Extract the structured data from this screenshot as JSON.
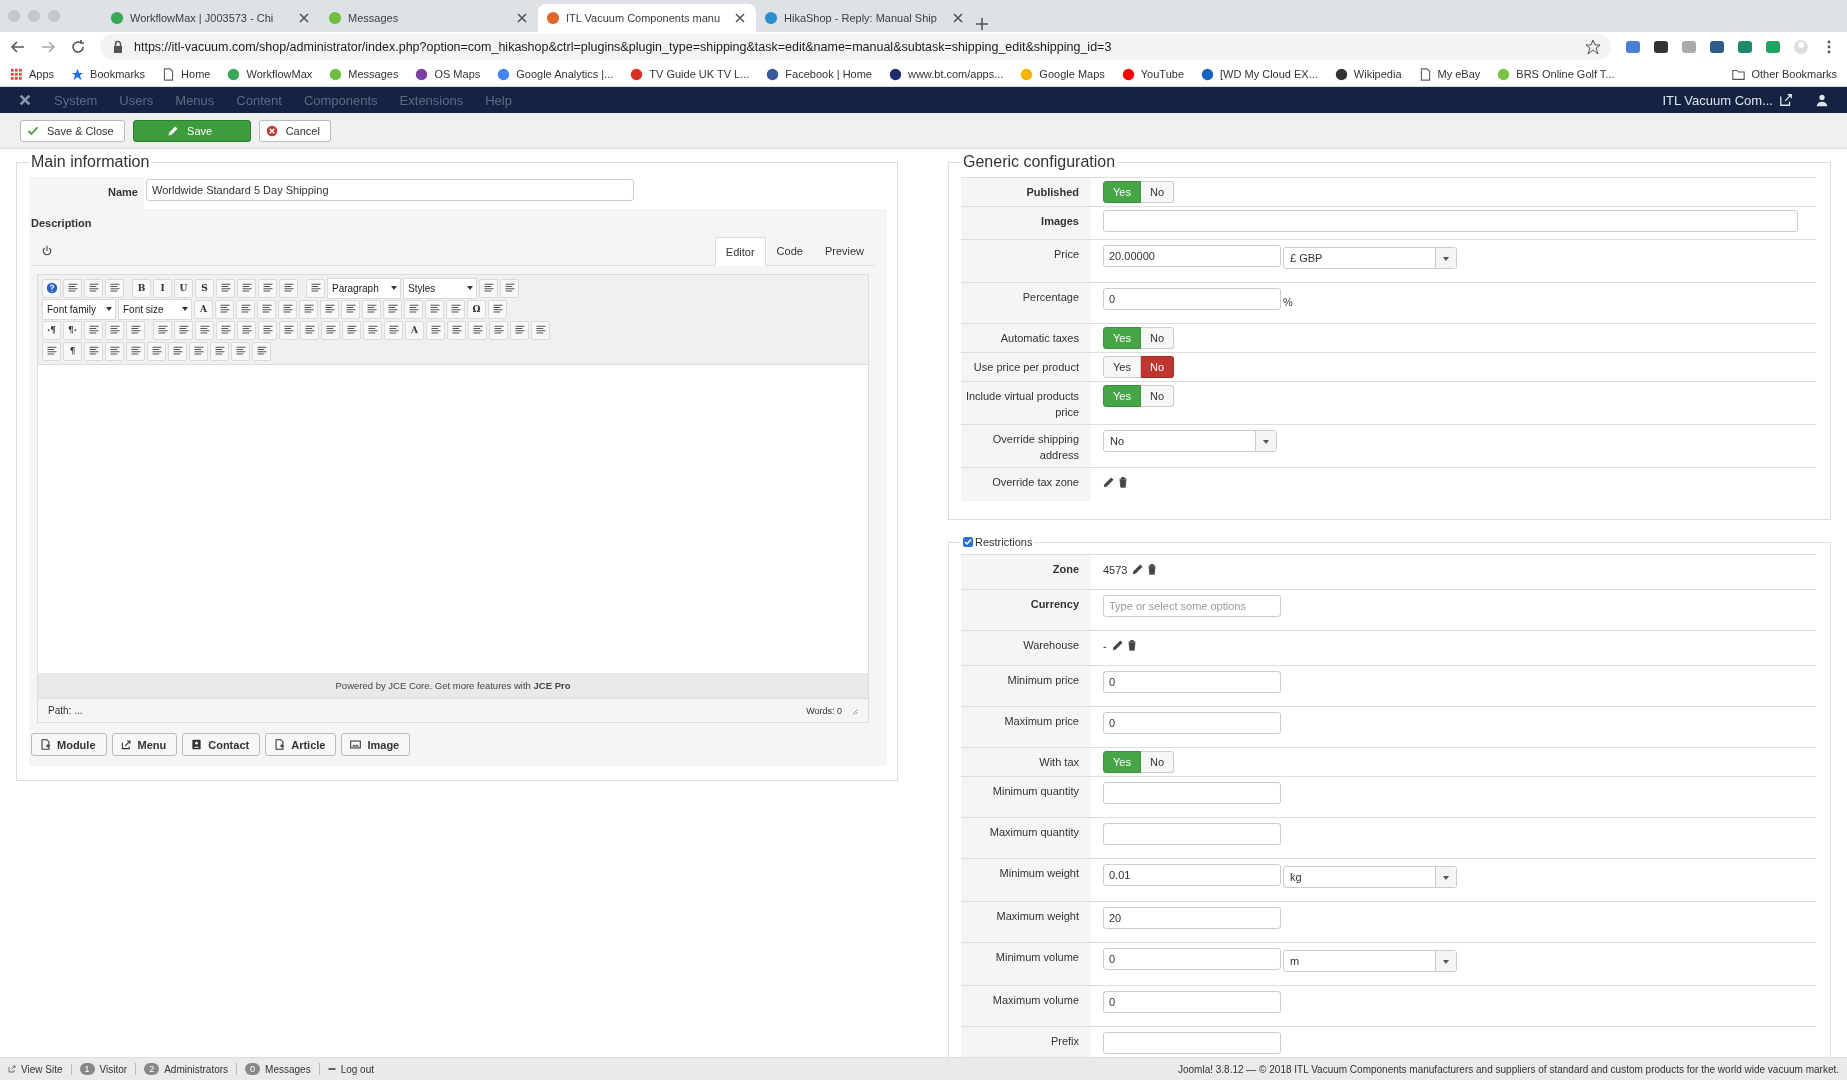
{
  "browser": {
    "tabs": [
      {
        "title": "WorkflowMax | J003573 - Chi",
        "color": "#3aa856",
        "selected": false
      },
      {
        "title": "Messages",
        "color": "#6fbf3f",
        "selected": false
      },
      {
        "title": "ITL Vacuum Components manu",
        "color": "#e0662b",
        "selected": true
      },
      {
        "title": "HikaShop - Reply: Manual Ship",
        "color": "#2d8fd0",
        "selected": false
      }
    ],
    "url": "https://itl-vacuum.com/shop/administrator/index.php?option=com_hikashop&ctrl=plugins&plugin_type=shipping&task=edit&name=manual&subtask=shipping_edit&shipping_id=3",
    "bookmarks": [
      {
        "label": "Apps",
        "kind": "grid",
        "color": "#e04a3f"
      },
      {
        "label": "Bookmarks",
        "kind": "star",
        "color": "#1a73e8"
      },
      {
        "label": "Home",
        "kind": "page",
        "color": "#5f6368"
      },
      {
        "label": "WorkflowMax",
        "kind": "dot",
        "color": "#3aa856"
      },
      {
        "label": "Messages",
        "kind": "dot",
        "color": "#6fbf3f"
      },
      {
        "label": "OS Maps",
        "kind": "dot",
        "color": "#7b3fa0"
      },
      {
        "label": "Google Analytics |...",
        "kind": "dot",
        "color": "#4285f4"
      },
      {
        "label": "TV Guide UK TV L...",
        "kind": "dot",
        "color": "#d93025"
      },
      {
        "label": "Facebook | Home",
        "kind": "dot",
        "color": "#3b5998"
      },
      {
        "label": "www.bt.com/apps...",
        "kind": "dot",
        "color": "#1f2b6e"
      },
      {
        "label": "Google Maps",
        "kind": "dot",
        "color": "#f4b400"
      },
      {
        "label": "YouTube",
        "kind": "dot",
        "color": "#ff0000"
      },
      {
        "label": "[WD My Cloud EX...",
        "kind": "dot",
        "color": "#1565c0"
      },
      {
        "label": "Wikipedia",
        "kind": "dot",
        "color": "#333333"
      },
      {
        "label": "My eBay",
        "kind": "page",
        "color": "#5f6368"
      },
      {
        "label": "BRS Online Golf T...",
        "kind": "dot",
        "color": "#7cc242"
      }
    ],
    "other_bookmarks": "Other Bookmarks"
  },
  "admin_menu": {
    "items": [
      "System",
      "Users",
      "Menus",
      "Content",
      "Components",
      "Extensions",
      "Help"
    ],
    "site_link": "ITL Vacuum Com..."
  },
  "toolbar": [
    {
      "label": "Save & Close",
      "kind": "check"
    },
    {
      "label": "Save",
      "kind": "primary"
    },
    {
      "label": "Cancel",
      "kind": "cancel"
    }
  ],
  "main_information": {
    "title": "Main information",
    "name_label": "Name",
    "name_value": "Worldwide Standard 5 Day Shipping",
    "description_label": "Description",
    "editor_tabs": [
      {
        "label": "Editor",
        "selected": true
      },
      {
        "label": "Code",
        "selected": false
      },
      {
        "label": "Preview",
        "selected": false
      }
    ],
    "editor_toolbar": [
      [
        {
          "kind": "help"
        },
        {
          "kind": "icon"
        },
        {
          "kind": "icon"
        },
        {
          "kind": "icon"
        },
        {
          "kind": "sep"
        },
        {
          "kind": "glyph",
          "text": "B"
        },
        {
          "kind": "glyph",
          "text": "I"
        },
        {
          "kind": "glyph",
          "text": "U"
        },
        {
          "kind": "glyph",
          "text": "S"
        },
        {
          "kind": "icon"
        },
        {
          "kind": "icon"
        },
        {
          "kind": "icon"
        },
        {
          "kind": "icon"
        },
        {
          "kind": "sep"
        },
        {
          "kind": "icon"
        },
        {
          "kind": "select",
          "text": "Paragraph"
        },
        {
          "kind": "select",
          "text": "Styles"
        },
        {
          "kind": "icon"
        },
        {
          "kind": "icon"
        }
      ],
      [
        {
          "kind": "select",
          "text": "Font family"
        },
        {
          "kind": "select",
          "text": "Font size"
        },
        {
          "kind": "glyph",
          "text": "A"
        },
        {
          "kind": "icon"
        },
        {
          "kind": "icon"
        },
        {
          "kind": "icon"
        },
        {
          "kind": "icon"
        },
        {
          "kind": "icon"
        },
        {
          "kind": "icon"
        },
        {
          "kind": "icon"
        },
        {
          "kind": "icon"
        },
        {
          "kind": "icon"
        },
        {
          "kind": "icon"
        },
        {
          "kind": "icon"
        },
        {
          "kind": "icon"
        },
        {
          "kind": "glyph",
          "text": "Ω"
        },
        {
          "kind": "icon"
        }
      ],
      [
        {
          "kind": "glyph",
          "text": "·¶"
        },
        {
          "kind": "glyph",
          "text": "¶·"
        },
        {
          "kind": "icon"
        },
        {
          "kind": "icon"
        },
        {
          "kind": "icon"
        },
        {
          "kind": "sep"
        },
        {
          "kind": "icon"
        },
        {
          "kind": "icon"
        },
        {
          "kind": "icon"
        },
        {
          "kind": "icon"
        },
        {
          "kind": "icon"
        },
        {
          "kind": "icon"
        },
        {
          "kind": "icon"
        },
        {
          "kind": "icon"
        },
        {
          "kind": "icon"
        },
        {
          "kind": "icon"
        },
        {
          "kind": "icon"
        },
        {
          "kind": "icon"
        },
        {
          "kind": "glyph",
          "text": "A"
        },
        {
          "kind": "icon"
        },
        {
          "kind": "icon"
        },
        {
          "kind": "icon"
        },
        {
          "kind": "icon"
        },
        {
          "kind": "icon"
        },
        {
          "kind": "icon"
        }
      ],
      [
        {
          "kind": "icon"
        },
        {
          "kind": "glyph",
          "text": "¶"
        },
        {
          "kind": "icon"
        },
        {
          "kind": "icon"
        },
        {
          "kind": "icon"
        },
        {
          "kind": "icon"
        },
        {
          "kind": "icon"
        },
        {
          "kind": "icon"
        },
        {
          "kind": "icon"
        },
        {
          "kind": "icon"
        },
        {
          "kind": "icon"
        }
      ]
    ],
    "editor_footer": "Powered by JCE Core. Get more features with **JCE Pro**",
    "path": "Path: ...",
    "words": "Words: 0",
    "insert_buttons": [
      {
        "label": "Module",
        "kind": "doc"
      },
      {
        "label": "Menu",
        "kind": "share"
      },
      {
        "label": "Contact",
        "kind": "card"
      },
      {
        "label": "Article",
        "kind": "doc"
      },
      {
        "label": "Image",
        "kind": "picture"
      }
    ]
  },
  "generic_configuration": {
    "title": "Generic configuration",
    "rows": [
      {
        "label": "Published",
        "strong": true,
        "kind": "toggle",
        "options": [
          {
            "label": "Yes",
            "kind": "yes",
            "selected": true
          },
          {
            "label": "No",
            "kind": "no",
            "selected": false
          }
        ]
      },
      {
        "label": "Images",
        "strong": true,
        "kind": "wide_input"
      },
      {
        "label": "Price",
        "strong": false,
        "kind": "input",
        "value": "20.00000",
        "select": "£ GBP"
      },
      {
        "label": "Percentage",
        "strong": false,
        "kind": "input",
        "value": "0",
        "suffix": "%"
      },
      {
        "label": "Automatic taxes",
        "strong": false,
        "kind": "toggle",
        "options": [
          {
            "label": "Yes",
            "kind": "yes",
            "selected": true
          },
          {
            "label": "No",
            "kind": "no",
            "selected": false
          }
        ]
      },
      {
        "label": "Use price per product",
        "strong": false,
        "kind": "toggle",
        "options": [
          {
            "label": "Yes",
            "kind": "yes",
            "selected": false
          },
          {
            "label": "No",
            "kind": "no",
            "selected": true
          }
        ]
      },
      {
        "label": "Include virtual products price",
        "strong": false,
        "kind": "toggle",
        "options": [
          {
            "label": "Yes",
            "kind": "yes",
            "selected": true
          },
          {
            "label": "No",
            "kind": "no",
            "selected": false
          }
        ]
      },
      {
        "label": "Override shipping address",
        "strong": false,
        "kind": "select",
        "value": "No"
      },
      {
        "label": "Override tax zone",
        "strong": false,
        "kind": "icons"
      }
    ]
  },
  "restrictions": {
    "title": "Restrictions",
    "checked": true,
    "rows": [
      {
        "label": "Zone",
        "strong": true,
        "kind": "icons",
        "value": "4573"
      },
      {
        "label": "Currency",
        "strong": true,
        "kind": "input",
        "placeholder": "Type or select some options"
      },
      {
        "label": "Warehouse",
        "strong": false,
        "kind": "icons",
        "value": "-"
      },
      {
        "label": "Minimum price",
        "strong": false,
        "kind": "input",
        "value": "0"
      },
      {
        "label": "Maximum price",
        "strong": false,
        "kind": "input",
        "value": "0"
      },
      {
        "label": "With tax",
        "strong": false,
        "kind": "toggle",
        "options": [
          {
            "label": "Yes",
            "kind": "yes",
            "selected": true
          },
          {
            "label": "No",
            "kind": "no",
            "selected": false
          }
        ]
      },
      {
        "label": "Minimum quantity",
        "strong": false,
        "kind": "input"
      },
      {
        "label": "Maximum quantity",
        "strong": false,
        "kind": "input"
      },
      {
        "label": "Minimum weight",
        "strong": false,
        "kind": "input",
        "value": "0.01",
        "select": "kg"
      },
      {
        "label": "Maximum weight",
        "strong": false,
        "kind": "input",
        "value": "20"
      },
      {
        "label": "Minimum volume",
        "strong": false,
        "kind": "input",
        "value": "0",
        "select": "m"
      },
      {
        "label": "Maximum volume",
        "strong": false,
        "kind": "input",
        "value": "0"
      },
      {
        "label": "Prefix",
        "strong": false,
        "kind": "input"
      }
    ]
  },
  "status_bar": {
    "items": [
      {
        "label": "View Site",
        "kind": "link"
      },
      {
        "label": "Visitor",
        "kind": "count",
        "count": "1"
      },
      {
        "label": "Administrators",
        "kind": "count",
        "count": "2"
      },
      {
        "label": "Messages",
        "kind": "count",
        "count": "0"
      },
      {
        "label": "Log out",
        "kind": "logout"
      }
    ],
    "copyright": "Joomla! 3.8.12  —  © 2018 ITL Vacuum Components manufacturers and suppliers of standard and custom products for the world wide vacuum market."
  }
}
